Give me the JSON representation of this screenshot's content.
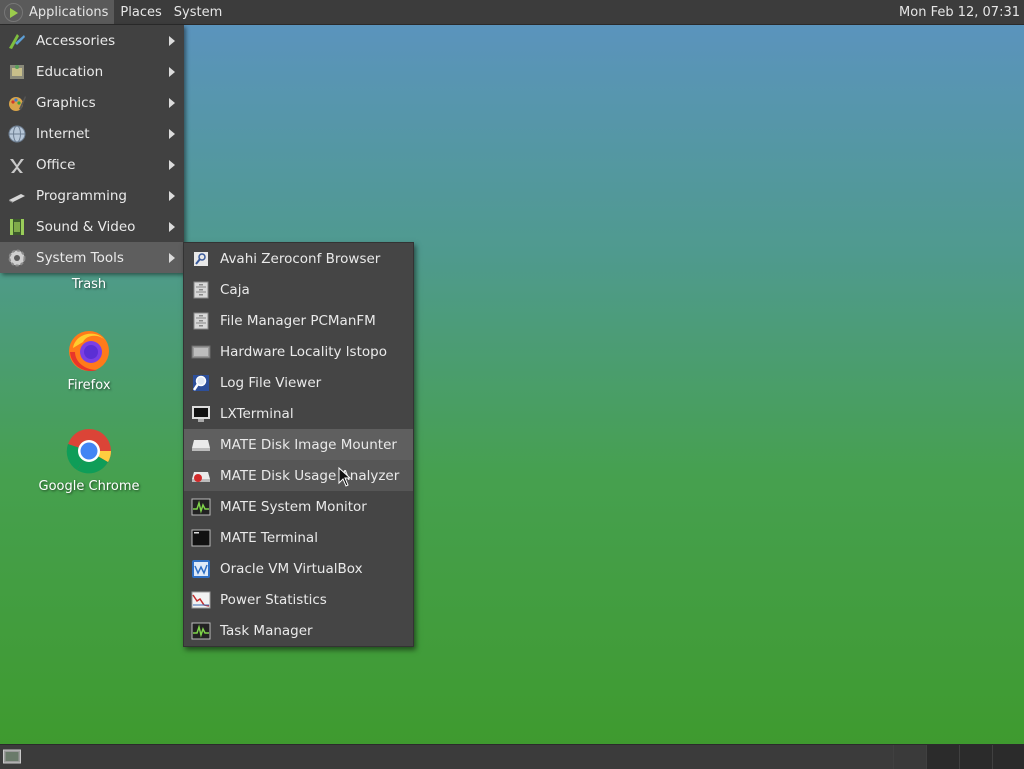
{
  "top_panel": {
    "menus": [
      "Applications",
      "Places",
      "System"
    ],
    "clock": "Mon Feb 12, 07:31"
  },
  "app_menu": {
    "items": [
      {
        "label": "Accessories",
        "icon": "accessories-icon"
      },
      {
        "label": "Education",
        "icon": "education-icon"
      },
      {
        "label": "Graphics",
        "icon": "graphics-icon"
      },
      {
        "label": "Internet",
        "icon": "internet-globe-icon"
      },
      {
        "label": "Office",
        "icon": "office-icon"
      },
      {
        "label": "Programming",
        "icon": "programming-icon"
      },
      {
        "label": "Sound & Video",
        "icon": "sound-video-icon"
      },
      {
        "label": "System Tools",
        "icon": "system-tools-gear-icon",
        "selected": true
      }
    ]
  },
  "system_tools_menu": {
    "items": [
      {
        "label": "Avahi Zeroconf Browser",
        "icon": "network-search-icon"
      },
      {
        "label": "Caja",
        "icon": "file-cabinet-icon"
      },
      {
        "label": "File Manager PCManFM",
        "icon": "file-cabinet-icon"
      },
      {
        "label": "Hardware Locality lstopo",
        "icon": "hardware-icon"
      },
      {
        "label": "Log File Viewer",
        "icon": "magnifier-icon"
      },
      {
        "label": "LXTerminal",
        "icon": "monitor-icon"
      },
      {
        "label": "MATE Disk Image Mounter",
        "icon": "disk-drive-icon",
        "highlighted": true
      },
      {
        "label": "MATE Disk Usage Analyzer",
        "icon": "disk-usage-icon",
        "hovered": true
      },
      {
        "label": "MATE System Monitor",
        "icon": "system-monitor-icon"
      },
      {
        "label": "MATE Terminal",
        "icon": "terminal-icon"
      },
      {
        "label": "Oracle VM VirtualBox",
        "icon": "virtualbox-icon"
      },
      {
        "label": "Power Statistics",
        "icon": "power-statistics-icon"
      },
      {
        "label": "Task Manager",
        "icon": "task-manager-icon"
      }
    ]
  },
  "desktop": {
    "icons": [
      {
        "label": "Trash",
        "icon": "trash-icon"
      },
      {
        "label": "Firefox",
        "icon": "firefox-icon"
      },
      {
        "label": "Google Chrome",
        "icon": "chrome-icon"
      }
    ]
  },
  "colors": {
    "panel": "#3c3c3c",
    "menu_bg": "#414141",
    "selected_bg": "#5e5e5e",
    "desktop_top": "#5c93c2",
    "desktop_bottom": "#3e9a2c"
  }
}
